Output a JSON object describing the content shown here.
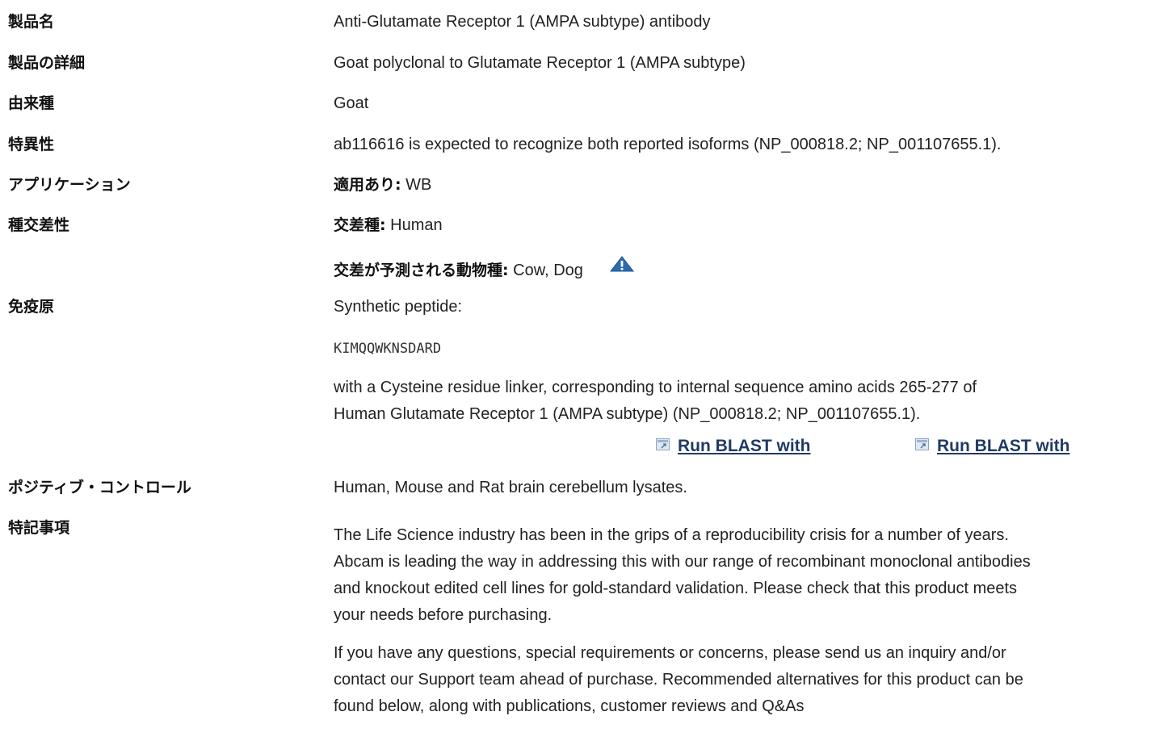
{
  "rows": {
    "product_name": {
      "label": "製品名",
      "value": "Anti-Glutamate Receptor 1 (AMPA subtype) antibody"
    },
    "product_detail": {
      "label": "製品の詳細",
      "value": "Goat polyclonal to Glutamate Receptor 1 (AMPA subtype)"
    },
    "host": {
      "label": "由来種",
      "value": "Goat"
    },
    "specificity": {
      "label": "特異性",
      "value": "ab116616 is expected to recognize both reported isoforms (NP_000818.2; NP_001107655.1)."
    },
    "application": {
      "label": "アプリケーション",
      "key": "適用あり:",
      "value": "WB"
    },
    "reactivity": {
      "label": "種交差性",
      "tested_key": "交差種:",
      "tested_value": "Human",
      "predicted_key": "交差が予測される動物種:",
      "predicted_value": "Cow, Dog",
      "warning_icon": "warning-triangle-icon"
    },
    "immunogen": {
      "label": "免疫原",
      "line1": "Synthetic peptide:",
      "sequence": "KIMQQWKNSDARD",
      "line3": "with a Cysteine residue linker, corresponding to internal sequence amino acids 265-277 of",
      "line4": "Human Glutamate Receptor 1 (AMPA subtype) (NP_000818.2; NP_001107655.1).",
      "blast_links": [
        "Run BLAST with",
        "Run BLAST with"
      ]
    },
    "positive_control": {
      "label": "ポジティブ・コントロール",
      "value": "Human, Mouse and Rat brain cerebellum lysates."
    },
    "notes": {
      "label": "特記事項",
      "para1_lines": [
        "The Life Science industry has been in the grips of a reproducibility crisis for a number of years.",
        "Abcam is leading the way in addressing this with our range of recombinant monoclonal antibodies",
        "and knockout edited cell lines for gold-standard validation. Please check that this product meets",
        "your needs before purchasing."
      ],
      "para2_lines": [
        "If you have any questions, special requirements or concerns, please send us an inquiry and/or",
        "contact our Support team ahead of purchase. Recommended alternatives for this product can be",
        "found below, along with publications, customer reviews and Q&As"
      ]
    }
  },
  "colors": {
    "link": "#1f3a66",
    "warning_icon": "#2a6cb0",
    "text": "#222222"
  }
}
